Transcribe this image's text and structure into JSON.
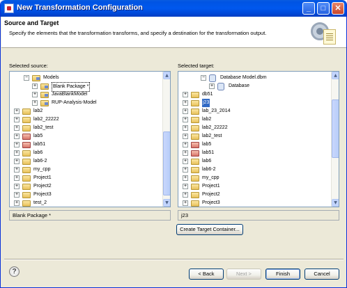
{
  "window": {
    "title": "New Transformation Configuration"
  },
  "header": {
    "title": "Source and Target",
    "description": "Specify the elements that the transformation transforms, and specify a destination for the transformation output."
  },
  "source": {
    "label": "Selected source:",
    "tree": [
      {
        "label": "Models",
        "expanded": true,
        "icon": "folder-model-icon"
      },
      {
        "label": "Blank Package *",
        "icon": "package-icon",
        "selected": true
      },
      {
        "label": "JavaBlankModel",
        "icon": "folder-icon"
      },
      {
        "label": "RUP-Analysis-Model",
        "icon": "folder-icon"
      },
      {
        "label": "lab2",
        "icon": "folder-icon"
      },
      {
        "label": "lab2_22222",
        "icon": "folder-icon"
      },
      {
        "label": "lab2_test",
        "icon": "folder-icon"
      },
      {
        "label": "lab5",
        "icon": "folder-icon"
      },
      {
        "label": "lab51",
        "icon": "folder-icon"
      },
      {
        "label": "lab6",
        "icon": "folder-icon"
      },
      {
        "label": "lab6-2",
        "icon": "folder-icon"
      },
      {
        "label": "my_cpp",
        "icon": "folder-icon"
      },
      {
        "label": "Project1",
        "icon": "folder-icon"
      },
      {
        "label": "Project2",
        "icon": "folder-icon"
      },
      {
        "label": "Project3",
        "icon": "folder-icon"
      },
      {
        "label": "test_2",
        "icon": "folder-icon"
      }
    ],
    "field_value": "Blank Package *"
  },
  "target": {
    "label": "Selected target:",
    "tree": [
      {
        "label": "Database Model.dbm",
        "icon": "database-model-icon"
      },
      {
        "label": "Database",
        "icon": "database-icon"
      },
      {
        "label": "db51",
        "icon": "folder-icon"
      },
      {
        "label": "j23",
        "icon": "folder-icon",
        "selected": true
      },
      {
        "label": "lab_23_2014",
        "icon": "folder-icon"
      },
      {
        "label": "lab2",
        "icon": "folder-icon"
      },
      {
        "label": "lab2_22222",
        "icon": "folder-icon"
      },
      {
        "label": "lab2_test",
        "icon": "folder-icon"
      },
      {
        "label": "lab5",
        "icon": "folder-icon"
      },
      {
        "label": "lab51",
        "icon": "folder-icon"
      },
      {
        "label": "lab6",
        "icon": "folder-icon"
      },
      {
        "label": "lab6-2",
        "icon": "folder-icon"
      },
      {
        "label": "my_cpp",
        "icon": "folder-icon"
      },
      {
        "label": "Project1",
        "icon": "folder-icon"
      },
      {
        "label": "Project2",
        "icon": "folder-icon"
      },
      {
        "label": "Project3",
        "icon": "folder-icon"
      }
    ],
    "field_value": "j23",
    "create_button": "Create Target Container..."
  },
  "footer": {
    "back": "< Back",
    "next": "Next >",
    "finish": "Finish",
    "cancel": "Cancel",
    "help": "?"
  },
  "titlebar_buttons": {
    "minimize": "_",
    "maximize": "□",
    "close": "✕"
  }
}
